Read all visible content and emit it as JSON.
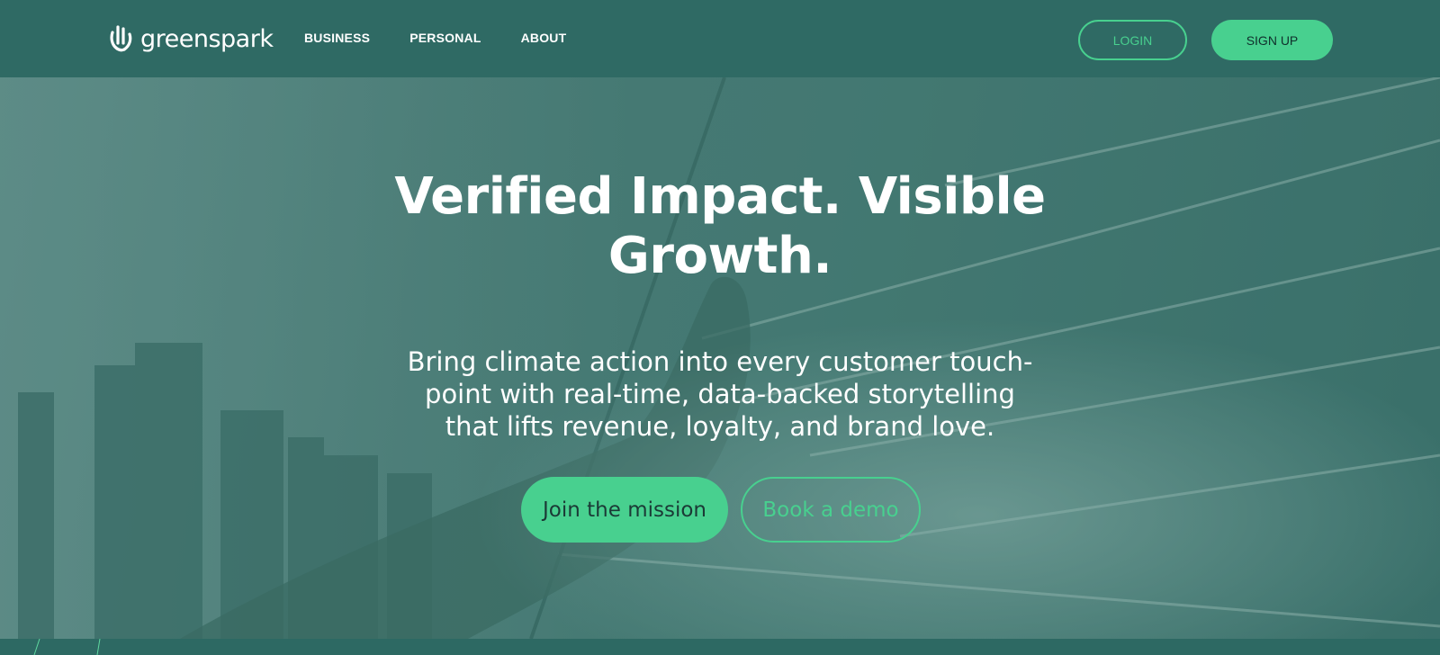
{
  "brand": {
    "name": "greenspark",
    "accent_color": "#48d08f",
    "header_color": "#2f6a64"
  },
  "nav": {
    "items": [
      {
        "label": "BUSINESS"
      },
      {
        "label": "PERSONAL"
      },
      {
        "label": "ABOUT"
      }
    ],
    "login_label": "LOGIN",
    "signup_label": "SIGN UP"
  },
  "hero": {
    "title_line1": "Verified Impact. Visible",
    "title_line2": "Growth.",
    "subtitle_line1": "Bring climate action into every customer touch-",
    "subtitle_line2": "point with real-time, data-backed storytelling",
    "subtitle_line3": "that lifts revenue, loyalty, and brand love.",
    "primary_cta": "Join the mission",
    "secondary_cta": "Book a demo"
  }
}
